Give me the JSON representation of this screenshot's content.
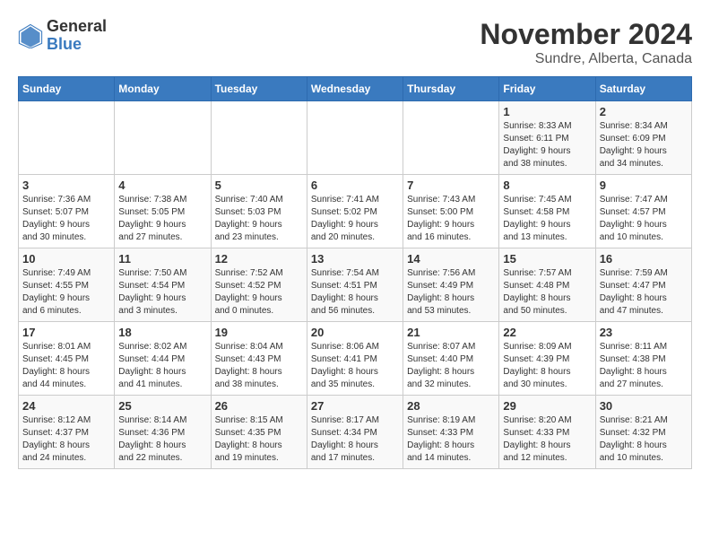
{
  "header": {
    "logo_general": "General",
    "logo_blue": "Blue",
    "month_title": "November 2024",
    "subtitle": "Sundre, Alberta, Canada"
  },
  "days_of_week": [
    "Sunday",
    "Monday",
    "Tuesday",
    "Wednesday",
    "Thursday",
    "Friday",
    "Saturday"
  ],
  "weeks": [
    [
      {
        "day": "",
        "info": ""
      },
      {
        "day": "",
        "info": ""
      },
      {
        "day": "",
        "info": ""
      },
      {
        "day": "",
        "info": ""
      },
      {
        "day": "",
        "info": ""
      },
      {
        "day": "1",
        "info": "Sunrise: 8:33 AM\nSunset: 6:11 PM\nDaylight: 9 hours\nand 38 minutes."
      },
      {
        "day": "2",
        "info": "Sunrise: 8:34 AM\nSunset: 6:09 PM\nDaylight: 9 hours\nand 34 minutes."
      }
    ],
    [
      {
        "day": "3",
        "info": "Sunrise: 7:36 AM\nSunset: 5:07 PM\nDaylight: 9 hours\nand 30 minutes."
      },
      {
        "day": "4",
        "info": "Sunrise: 7:38 AM\nSunset: 5:05 PM\nDaylight: 9 hours\nand 27 minutes."
      },
      {
        "day": "5",
        "info": "Sunrise: 7:40 AM\nSunset: 5:03 PM\nDaylight: 9 hours\nand 23 minutes."
      },
      {
        "day": "6",
        "info": "Sunrise: 7:41 AM\nSunset: 5:02 PM\nDaylight: 9 hours\nand 20 minutes."
      },
      {
        "day": "7",
        "info": "Sunrise: 7:43 AM\nSunset: 5:00 PM\nDaylight: 9 hours\nand 16 minutes."
      },
      {
        "day": "8",
        "info": "Sunrise: 7:45 AM\nSunset: 4:58 PM\nDaylight: 9 hours\nand 13 minutes."
      },
      {
        "day": "9",
        "info": "Sunrise: 7:47 AM\nSunset: 4:57 PM\nDaylight: 9 hours\nand 10 minutes."
      }
    ],
    [
      {
        "day": "10",
        "info": "Sunrise: 7:49 AM\nSunset: 4:55 PM\nDaylight: 9 hours\nand 6 minutes."
      },
      {
        "day": "11",
        "info": "Sunrise: 7:50 AM\nSunset: 4:54 PM\nDaylight: 9 hours\nand 3 minutes."
      },
      {
        "day": "12",
        "info": "Sunrise: 7:52 AM\nSunset: 4:52 PM\nDaylight: 9 hours\nand 0 minutes."
      },
      {
        "day": "13",
        "info": "Sunrise: 7:54 AM\nSunset: 4:51 PM\nDaylight: 8 hours\nand 56 minutes."
      },
      {
        "day": "14",
        "info": "Sunrise: 7:56 AM\nSunset: 4:49 PM\nDaylight: 8 hours\nand 53 minutes."
      },
      {
        "day": "15",
        "info": "Sunrise: 7:57 AM\nSunset: 4:48 PM\nDaylight: 8 hours\nand 50 minutes."
      },
      {
        "day": "16",
        "info": "Sunrise: 7:59 AM\nSunset: 4:47 PM\nDaylight: 8 hours\nand 47 minutes."
      }
    ],
    [
      {
        "day": "17",
        "info": "Sunrise: 8:01 AM\nSunset: 4:45 PM\nDaylight: 8 hours\nand 44 minutes."
      },
      {
        "day": "18",
        "info": "Sunrise: 8:02 AM\nSunset: 4:44 PM\nDaylight: 8 hours\nand 41 minutes."
      },
      {
        "day": "19",
        "info": "Sunrise: 8:04 AM\nSunset: 4:43 PM\nDaylight: 8 hours\nand 38 minutes."
      },
      {
        "day": "20",
        "info": "Sunrise: 8:06 AM\nSunset: 4:41 PM\nDaylight: 8 hours\nand 35 minutes."
      },
      {
        "day": "21",
        "info": "Sunrise: 8:07 AM\nSunset: 4:40 PM\nDaylight: 8 hours\nand 32 minutes."
      },
      {
        "day": "22",
        "info": "Sunrise: 8:09 AM\nSunset: 4:39 PM\nDaylight: 8 hours\nand 30 minutes."
      },
      {
        "day": "23",
        "info": "Sunrise: 8:11 AM\nSunset: 4:38 PM\nDaylight: 8 hours\nand 27 minutes."
      }
    ],
    [
      {
        "day": "24",
        "info": "Sunrise: 8:12 AM\nSunset: 4:37 PM\nDaylight: 8 hours\nand 24 minutes."
      },
      {
        "day": "25",
        "info": "Sunrise: 8:14 AM\nSunset: 4:36 PM\nDaylight: 8 hours\nand 22 minutes."
      },
      {
        "day": "26",
        "info": "Sunrise: 8:15 AM\nSunset: 4:35 PM\nDaylight: 8 hours\nand 19 minutes."
      },
      {
        "day": "27",
        "info": "Sunrise: 8:17 AM\nSunset: 4:34 PM\nDaylight: 8 hours\nand 17 minutes."
      },
      {
        "day": "28",
        "info": "Sunrise: 8:19 AM\nSunset: 4:33 PM\nDaylight: 8 hours\nand 14 minutes."
      },
      {
        "day": "29",
        "info": "Sunrise: 8:20 AM\nSunset: 4:33 PM\nDaylight: 8 hours\nand 12 minutes."
      },
      {
        "day": "30",
        "info": "Sunrise: 8:21 AM\nSunset: 4:32 PM\nDaylight: 8 hours\nand 10 minutes."
      }
    ]
  ]
}
